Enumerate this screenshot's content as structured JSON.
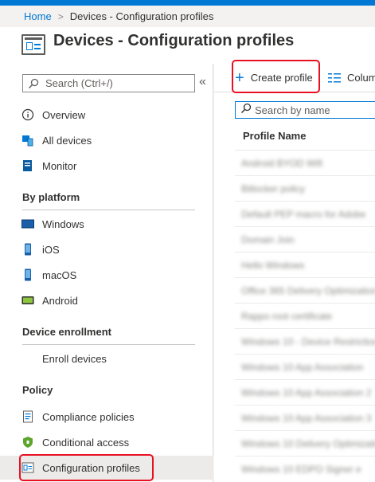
{
  "breadcrumb": {
    "home": "Home",
    "separator": ">",
    "current": "Devices - Configuration profiles"
  },
  "header": {
    "title": "Devices - Configuration profiles",
    "icon": "configuration-profiles-icon"
  },
  "sidebar": {
    "search_placeholder": "Search (Ctrl+/)",
    "collapse_label": "«",
    "items": [
      {
        "label": "Overview",
        "icon": "info-icon"
      },
      {
        "label": "All devices",
        "icon": "devices-icon"
      },
      {
        "label": "Monitor",
        "icon": "monitor-icon"
      }
    ],
    "sections": [
      {
        "title": "By platform",
        "items": [
          {
            "label": "Windows",
            "icon": "windows-device-icon"
          },
          {
            "label": "iOS",
            "icon": "ios-device-icon"
          },
          {
            "label": "macOS",
            "icon": "macos-device-icon"
          },
          {
            "label": "Android",
            "icon": "android-device-icon"
          }
        ]
      },
      {
        "title": "Device enrollment",
        "items": [
          {
            "label": "Enroll devices"
          }
        ]
      },
      {
        "title": "Policy",
        "items": [
          {
            "label": "Compliance policies",
            "icon": "compliance-icon"
          },
          {
            "label": "Conditional access",
            "icon": "shield-icon"
          },
          {
            "label": "Configuration profiles",
            "icon": "configuration-profiles-icon",
            "selected": true
          }
        ]
      }
    ]
  },
  "toolbar": {
    "create_label": "Create profile",
    "columns_label": "Colum"
  },
  "content": {
    "search_placeholder": "Search by name",
    "column_header": "Profile Name",
    "rows": [
      {
        "text": "Android BYOD Wifi",
        "trail": ""
      },
      {
        "text": "Bitlocker policy",
        "trail": ""
      },
      {
        "text": "Default PEP macro for Adobe",
        "trail": ""
      },
      {
        "text": "Domain Join",
        "trail": ""
      },
      {
        "text": "Hello Windows",
        "trail": ""
      },
      {
        "text": "Office 365 Delivery Optimization",
        "trail": ""
      },
      {
        "text": "Rappo root certificate",
        "trail": ""
      },
      {
        "text": "Windows 10 - Device Restrictions",
        "trail": ""
      },
      {
        "text": "Windows 10 App Association",
        "trail": ""
      },
      {
        "text": "Windows 10 App Association 2",
        "trail": ""
      },
      {
        "text": "Windows 10 App Association 3",
        "trail": ""
      },
      {
        "text": "Windows 10 Delivery Optimization",
        "trail": ""
      },
      {
        "text": "Windows 10 EDPO Signer e",
        "trail": ""
      }
    ]
  },
  "colors": {
    "accent": "#0078d4",
    "highlight": "#e81123",
    "selected_bg": "#edebe9"
  }
}
